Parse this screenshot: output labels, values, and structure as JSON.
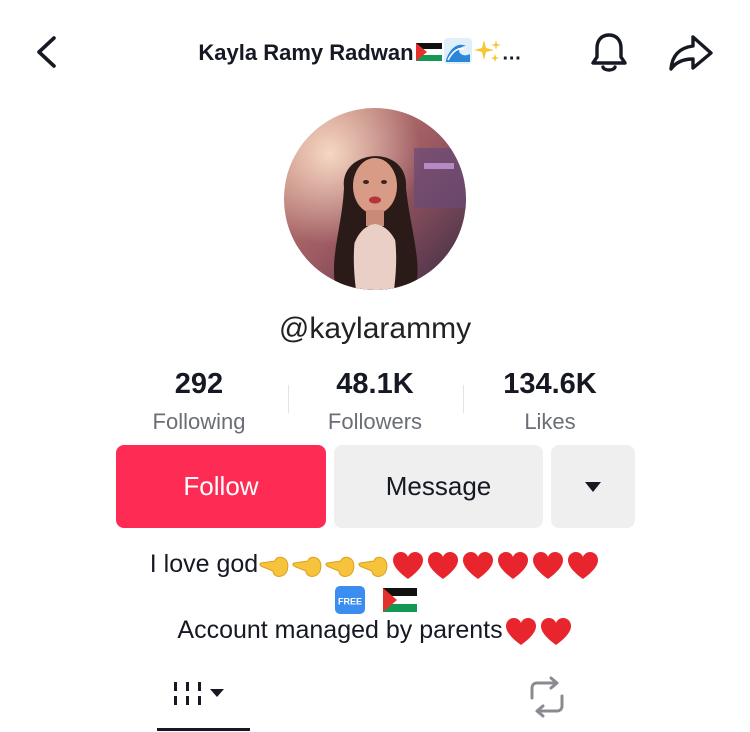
{
  "header": {
    "title": "Kayla Ramy Radwan",
    "title_extra": "…",
    "icons": [
      "back-arrow-icon",
      "palestine-flag-icon",
      "wave-icon",
      "sparkles-icon",
      "bell-icon",
      "share-icon"
    ]
  },
  "profile": {
    "username": "@kaylarammy"
  },
  "stats": [
    {
      "value": "292",
      "label": "Following"
    },
    {
      "value": "48.1K",
      "label": "Followers"
    },
    {
      "value": "134.6K",
      "label": "Likes"
    }
  ],
  "actions": {
    "follow_label": "Follow",
    "message_label": "Message"
  },
  "bio": {
    "line1": "I love god",
    "line1_emojis": [
      "backhand-index-left-icon",
      "backhand-index-left-icon",
      "backhand-index-left-icon",
      "backhand-index-left-icon",
      "heart-icon",
      "heart-icon",
      "heart-icon",
      "heart-icon",
      "heart-icon",
      "heart-icon"
    ],
    "line2_emojis": [
      "free-button-icon",
      "palestine-flag-icon"
    ],
    "line3": "Account managed by parents",
    "line3_emojis": [
      "heart-icon",
      "heart-icon"
    ]
  },
  "tabs": [
    {
      "name": "videos-grid-tab",
      "selected": true
    },
    {
      "name": "reposts-tab",
      "selected": false
    }
  ],
  "colors": {
    "accent": "#fe2c55",
    "secondary_button": "#efefef",
    "text": "#161823",
    "muted": "#6b6e76",
    "heart": "#e8242d"
  }
}
